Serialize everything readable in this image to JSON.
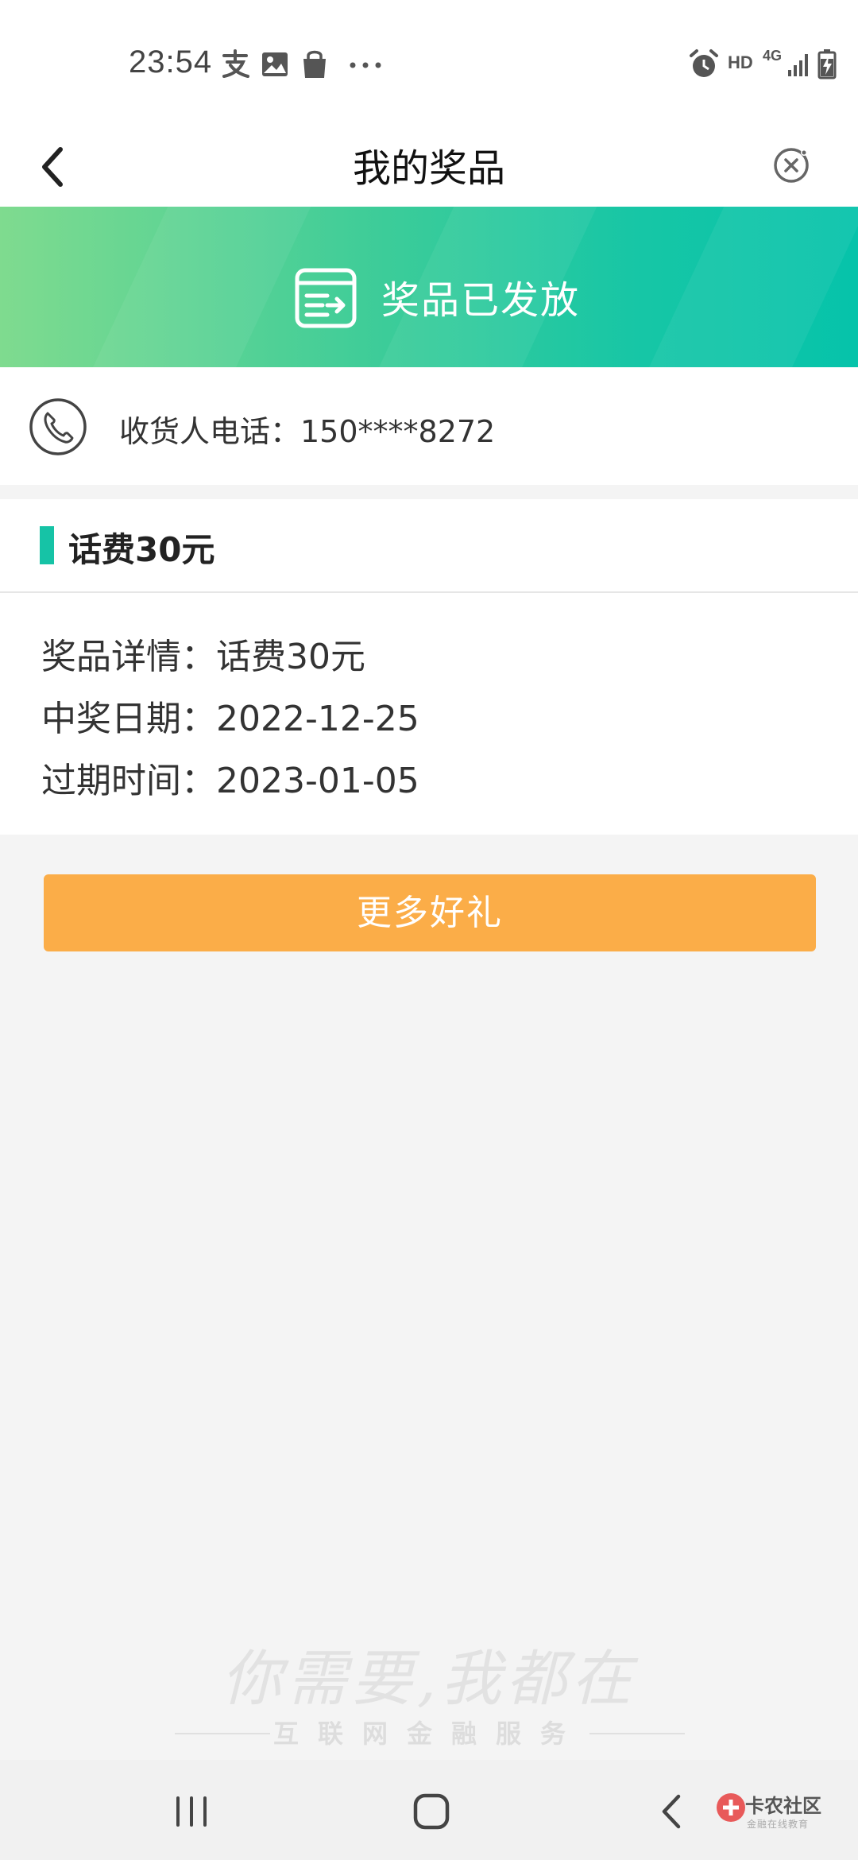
{
  "status_bar": {
    "time": "23:54",
    "hd_label": "HD",
    "network_label": "4G",
    "left_icons": [
      "alipay-icon",
      "image-icon",
      "shopping-bag-icon",
      "more-dots-icon"
    ],
    "right_icons": [
      "alarm-icon",
      "signal-icon",
      "battery-charging-icon"
    ]
  },
  "header": {
    "title": "我的奖品"
  },
  "banner": {
    "status_text": "奖品已发放",
    "icon": "delivered-box-icon",
    "colors": {
      "start": "#7fdb8f",
      "end": "#06c3aa"
    }
  },
  "receiver": {
    "label": "收货人电话：150****8272",
    "icon": "phone-icon"
  },
  "prize": {
    "title": "话费30元",
    "accent_color": "#16c3a6",
    "details": [
      "奖品详情：话费30元",
      "中奖日期：2022-12-25",
      "过期时间：2023-01-05"
    ]
  },
  "actions": {
    "more_gifts_label": "更多好礼",
    "button_color": "#fbad48"
  },
  "watermark": {
    "script_text": "你需要,我都在",
    "sub_text": "互联网金融服务"
  },
  "nav_bar": {
    "brand_name": "卡农社区",
    "brand_sub": "金融在线教育"
  }
}
